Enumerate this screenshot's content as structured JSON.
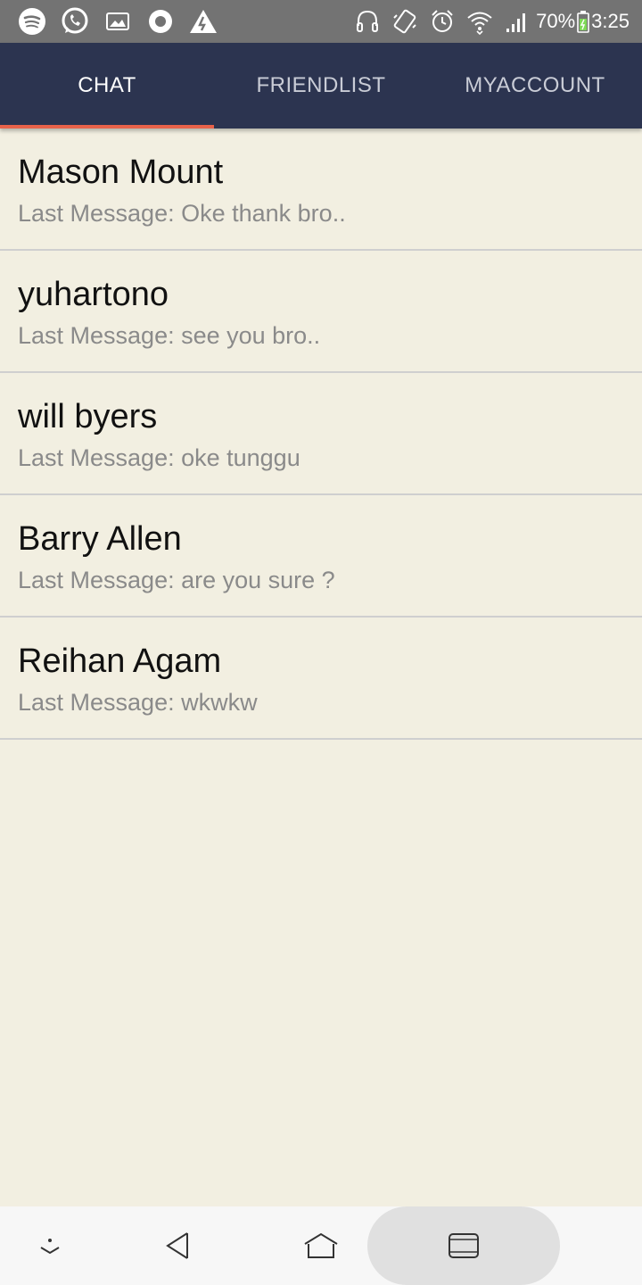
{
  "status_bar": {
    "left_icons": [
      "spotify-icon",
      "whatsapp-icon",
      "image-icon",
      "circle-app-icon",
      "warning-icon"
    ],
    "right_icons": [
      "headphones-icon",
      "vibrate-icon",
      "alarm-icon",
      "wifi-icon",
      "signal-icon"
    ],
    "battery": "70%",
    "time": "3:25"
  },
  "tabs": [
    {
      "label": "CHAT",
      "active": true
    },
    {
      "label": "FRIENDLIST",
      "active": false
    },
    {
      "label": "MYACCOUNT",
      "active": false
    }
  ],
  "chats": [
    {
      "name": "Mason Mount",
      "last_message": "Last Message: Oke thank bro.."
    },
    {
      "name": "yuhartono",
      "last_message": "Last Message: see you bro.."
    },
    {
      "name": "will byers",
      "last_message": "Last Message: oke tunggu"
    },
    {
      "name": "Barry Allen",
      "last_message": "Last Message: are you sure ?"
    },
    {
      "name": "Reihan Agam",
      "last_message": "Last Message: wkwkw"
    }
  ],
  "nav_bar": {
    "icons": [
      "hide-nav-icon",
      "back-icon",
      "home-icon",
      "recents-icon"
    ]
  },
  "colors": {
    "tab_bar": "#2c3450",
    "tab_indicator": "#e8624a",
    "background": "#f2efe1",
    "status_bar": "#737373"
  }
}
